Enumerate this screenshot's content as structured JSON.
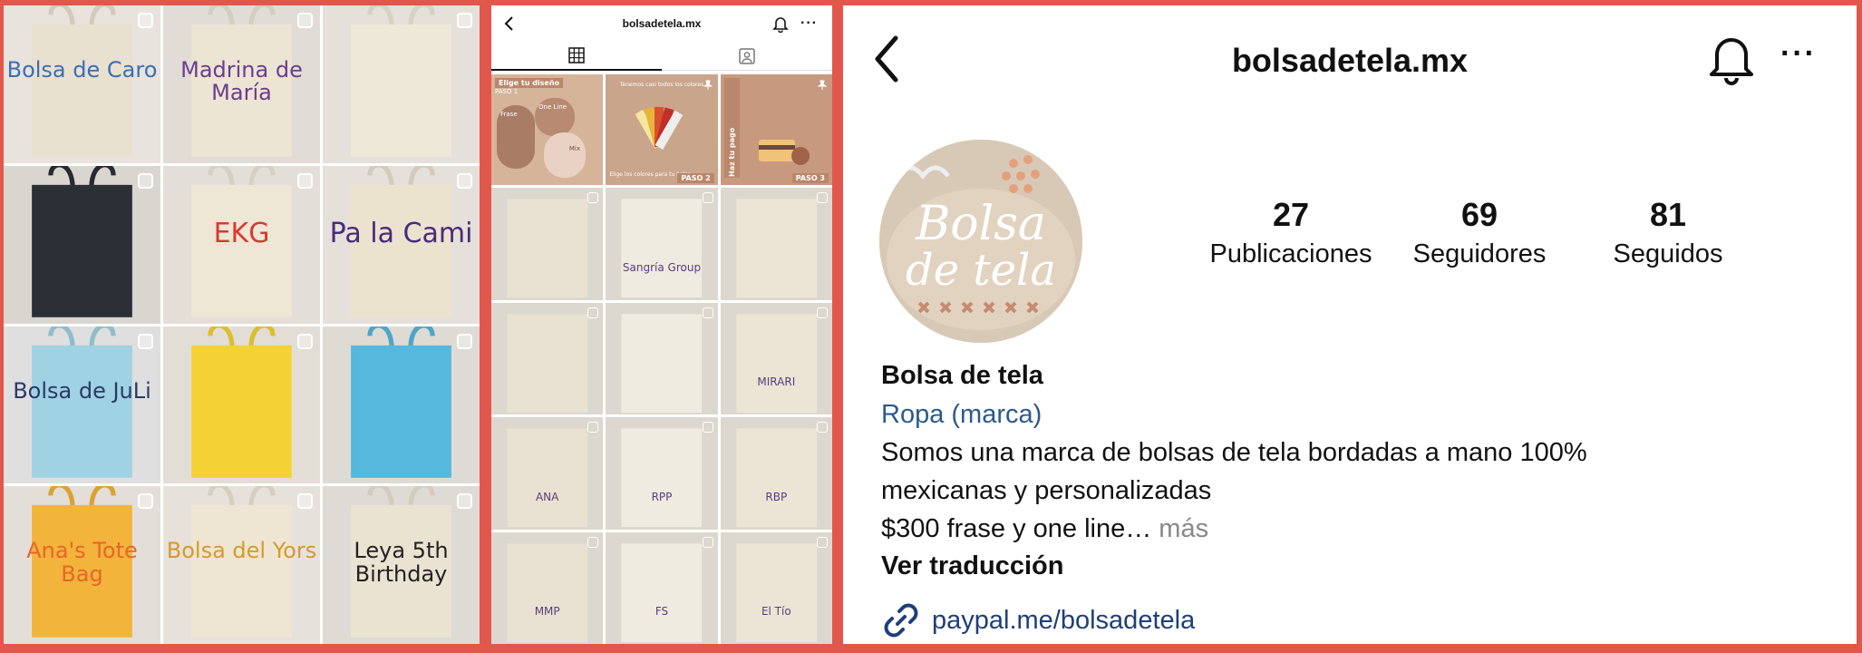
{
  "colors": {
    "background": "#e2574c",
    "link": "#1f3f7a",
    "category": "#2c5a8c"
  },
  "left_grid": {
    "tiles": [
      {
        "text": "Bolsa de Caro",
        "bg": "#e8e3dc",
        "bag": "#e9e1cf",
        "color": "#3a6fb4"
      },
      {
        "text": "Madrina de María",
        "bg": "#e1ddd6",
        "bag": "#ece5d4",
        "color": "#6d3c8f"
      },
      {
        "text": "",
        "bg": "#e5e1da",
        "bag": "#eee8d8",
        "color": "#333"
      },
      {
        "text": "",
        "bg": "#d9d6d0",
        "bag": "#2b2f36",
        "color": "#fff"
      },
      {
        "text": "EKG",
        "bg": "#e3dfd8",
        "bag": "#eee7d6",
        "color": "#d83b2f"
      },
      {
        "text": "Pa la Cami",
        "bg": "#e5e1da",
        "bag": "#ece3cf",
        "color": "#4b2a7a"
      },
      {
        "text": "Bolsa de JuLi",
        "bg": "#dfdfdf",
        "bag": "#9fd2e2",
        "color": "#2a3a6a"
      },
      {
        "text": "",
        "bg": "#e2ded6",
        "bag": "#f4d235",
        "color": "#e86d30"
      },
      {
        "text": "",
        "bg": "#dedbd5",
        "bag": "#55b8dd",
        "color": "#2f8bb8"
      },
      {
        "text": "Ana's Tote Bag",
        "bg": "#e3dfd8",
        "bag": "#f2b43a",
        "color": "#e7662b"
      },
      {
        "text": "Bolsa del Yors",
        "bg": "#e6e2db",
        "bag": "#eee6d3",
        "color": "#d69a2c"
      },
      {
        "text": "Leya 5th Birthday",
        "bg": "#dedbd4",
        "bag": "#eae3d2",
        "color": "#222"
      }
    ]
  },
  "middle": {
    "title": "bolsadetela.mx",
    "more": "···",
    "promos": [
      {
        "header": "Elige tu diseño",
        "paso": "PASO 1",
        "frase": "Frase",
        "oneline": "One Line",
        "mix": "Mix"
      },
      {
        "header": "Tenemos casi todos los colores",
        "paso": "PASO 2",
        "footer": "Elige los colores para tu bolsa"
      },
      {
        "header": "Haz tu pago",
        "paso": "PASO 3"
      }
    ],
    "tiles": [
      {
        "text": ""
      },
      {
        "text": "Sangría Group"
      },
      {
        "text": ""
      },
      {
        "text": ""
      },
      {
        "text": ""
      },
      {
        "text": "MIRARI"
      },
      {
        "text": "ANA"
      },
      {
        "text": "RPP"
      },
      {
        "text": "RBP"
      },
      {
        "text": "MMP"
      },
      {
        "text": "FS"
      },
      {
        "text": "El Tío"
      }
    ]
  },
  "profile": {
    "title": "bolsadetela.mx",
    "more": "···",
    "avatar_text": "Bolsa de tela",
    "stats": [
      {
        "value": "27",
        "label": "Publicaciones"
      },
      {
        "value": "69",
        "label": "Seguidores"
      },
      {
        "value": "81",
        "label": "Seguidos"
      }
    ],
    "name": "Bolsa de tela",
    "category": "Ropa (marca)",
    "bio_line1": "Somos una marca de bolsas de tela bordadas a mano 100%",
    "bio_line2": "mexicanas y personalizadas",
    "bio_line3": "$300 frase y one line…",
    "more_label": " más",
    "translate": "Ver traducción",
    "link": "paypal.me/bolsadetela"
  }
}
